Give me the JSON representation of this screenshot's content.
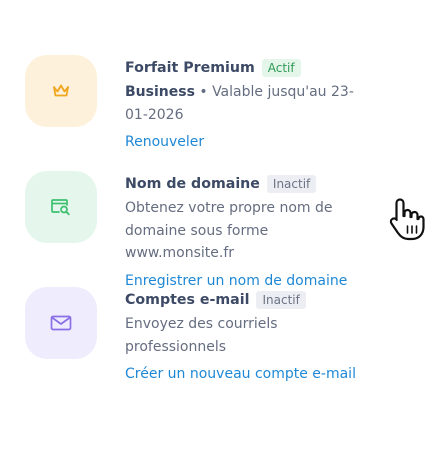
{
  "items": [
    {
      "title": "Forfait Premium",
      "badge": "Actif",
      "badge_state": "active",
      "desc_strong": "Business",
      "desc": " • Valable jusqu'au 23-01-2026",
      "link": "Renouveler",
      "icon": "crown-icon",
      "tile_color": "#fdf1dc",
      "icon_color": "#f0a51e"
    },
    {
      "title": "Nom de domaine",
      "badge": "Inactif",
      "badge_state": "inactive",
      "desc": "Obtenez votre propre nom de domaine sous forme www.monsite.fr",
      "link": "Enregistrer un nom de domaine",
      "icon": "domain-search-icon",
      "tile_color": "#e5f7ec",
      "icon_color": "#3cbf6f"
    },
    {
      "title": "Comptes e-mail",
      "badge": "Inactif",
      "badge_state": "inactive",
      "desc": "Envoyez des courriels professionnels",
      "link": "Créer un nouveau compte e-mail",
      "icon": "envelope-icon",
      "tile_color": "#efecfd",
      "icon_color": "#8b6fe8"
    }
  ],
  "colors": {
    "title": "#3d4a66",
    "text": "#656d80",
    "link": "#1e88d6"
  }
}
